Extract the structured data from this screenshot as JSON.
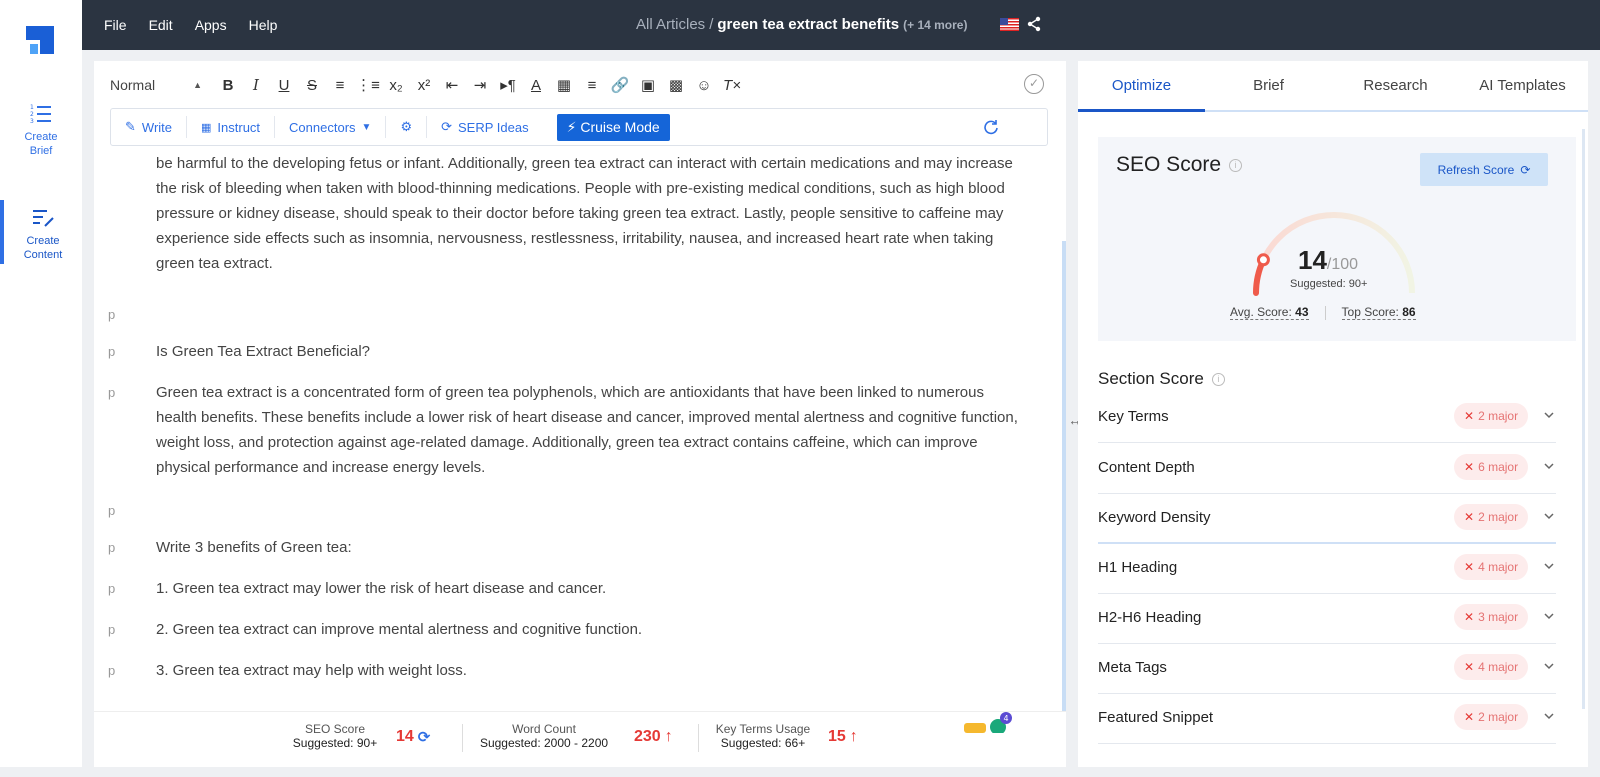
{
  "topbar": {
    "menu": [
      "File",
      "Edit",
      "Apps",
      "Help"
    ],
    "breadcrumb_root": "All Articles",
    "breadcrumb_sep": "/",
    "article_title": "green tea extract benefits",
    "more_label": "(+ 14 more)"
  },
  "rail": {
    "items": [
      {
        "label_line1": "Create",
        "label_line2": "Brief"
      },
      {
        "label_line1": "Create",
        "label_line2": "Content"
      }
    ]
  },
  "toolbar": {
    "block_style": "Normal",
    "write_label": "Write",
    "instruct_label": "Instruct",
    "connectors_label": "Connectors",
    "serp_label": "SERP Ideas",
    "cruise_label": "Cruise Mode"
  },
  "content": {
    "paragraphs": [
      {
        "tag": "",
        "text": "be harmful to the developing fetus or infant. Additionally, green tea extract can interact with certain medications and may increase the risk of bleeding when taken with blood-thinning medications. People with pre-existing medical conditions, such as high blood pressure or kidney disease, should speak to their doctor before taking green tea extract. Lastly, people sensitive to caffeine may experience side effects such as insomnia, nervousness, restlessness, irritability, nausea, and increased heart rate when taking green tea extract."
      },
      {
        "tag": "p",
        "text": ""
      },
      {
        "tag": "p",
        "text": "Is Green Tea Extract Beneficial?"
      },
      {
        "tag": "p",
        "text": "Green tea extract is a concentrated form of green tea polyphenols, which are antioxidants that have been linked to numerous health benefits. These benefits include a lower risk of heart disease and cancer, improved mental alertness and cognitive function, weight loss, and protection against age-related damage. Additionally, green tea extract contains caffeine, which can improve physical performance and increase energy levels."
      },
      {
        "tag": "p",
        "text": ""
      },
      {
        "tag": "p",
        "text": "Write 3 benefits of Green tea:"
      },
      {
        "tag": "p",
        "text": "1. Green tea extract may lower the risk of heart disease and cancer."
      },
      {
        "tag": "p",
        "text": "2. Green tea extract can improve mental alertness and cognitive function."
      },
      {
        "tag": "p",
        "text": "3. Green tea extract may help with weight loss."
      }
    ],
    "bubble_count": "4"
  },
  "stats": {
    "seo": {
      "label": "SEO Score",
      "sub": "Suggested: 90+",
      "value": "14"
    },
    "words": {
      "label": "Word Count",
      "sub": "Suggested: 2000 - 2200",
      "value": "230"
    },
    "terms": {
      "label": "Key Terms Usage",
      "sub": "Suggested: 66+",
      "value": "15"
    }
  },
  "rpanel": {
    "tabs": [
      "Optimize",
      "Brief",
      "Research",
      "AI Templates"
    ],
    "seo_title": "SEO Score",
    "refresh_label": "Refresh Score",
    "score": "14",
    "score_max": "/100",
    "score_fraction": 0.14,
    "suggested": "Suggested: 90+",
    "avg_label": "Avg. Score:",
    "avg_value": "43",
    "top_label": "Top Score:",
    "top_value": "86",
    "section_title": "Section Score",
    "sections": [
      {
        "name": "Key Terms",
        "badge": "2 major"
      },
      {
        "name": "Content Depth",
        "badge": "6 major"
      },
      {
        "name": "Keyword Density",
        "badge": "2 major"
      },
      {
        "name": "H1 Heading",
        "badge": "4 major"
      },
      {
        "name": "H2-H6 Heading",
        "badge": "3 major"
      },
      {
        "name": "Meta Tags",
        "badge": "4 major"
      },
      {
        "name": "Featured Snippet",
        "badge": "2 major"
      }
    ]
  },
  "colors": {
    "accent": "#1a56c7",
    "topbar": "#2b3441",
    "danger": "#e53935"
  }
}
